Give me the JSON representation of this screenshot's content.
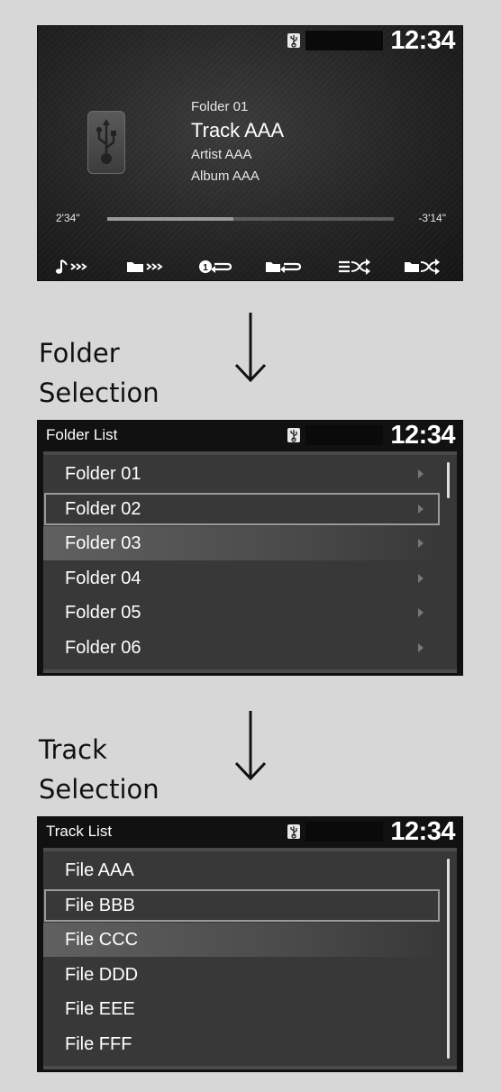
{
  "now_playing": {
    "clock": "12:34",
    "folder": "Folder 01",
    "track": "Track AAA",
    "artist": "Artist AAA",
    "album": "Album AAA",
    "elapsed": "2'34\"",
    "remaining": "-3'14\"",
    "progress": 0.44,
    "controls": [
      "track-up-icon",
      "folder-up-icon",
      "repeat-one-icon",
      "repeat-folder-icon",
      "shuffle-icon",
      "shuffle-folder-icon"
    ]
  },
  "captions": {
    "folder_selection": [
      "Folder",
      "Selection"
    ],
    "track_selection": [
      "Track",
      "Selection"
    ]
  },
  "folder_list": {
    "title": "Folder List",
    "clock": "12:34",
    "items": [
      "Folder 01",
      "Folder 02",
      "Folder 03",
      "Folder 04",
      "Folder 05",
      "Folder 06"
    ],
    "focused_index": 1,
    "highlight_index": 2
  },
  "track_list": {
    "title": "Track List",
    "clock": "12:34",
    "items": [
      "File AAA",
      "File BBB",
      "File CCC",
      "File DDD",
      "File EEE",
      "File FFF"
    ],
    "focused_index": 1,
    "highlight_index": 2
  }
}
